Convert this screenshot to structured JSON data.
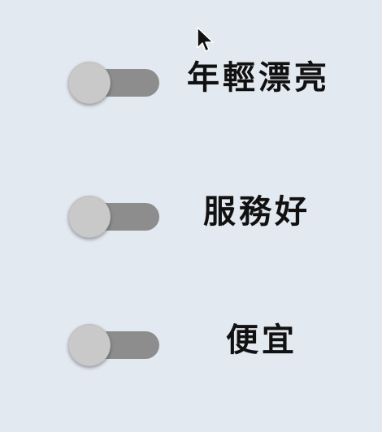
{
  "options": [
    {
      "label": "年輕漂亮",
      "on": false
    },
    {
      "label": "服務好",
      "on": false
    },
    {
      "label": "便宜",
      "on": false
    }
  ],
  "colors": {
    "background": "#e3e9f0",
    "track": "#8d8d8d",
    "thumb": "#c9c9c9",
    "text": "#111111"
  },
  "icons": {
    "cursor": "mouse-pointer-icon"
  }
}
